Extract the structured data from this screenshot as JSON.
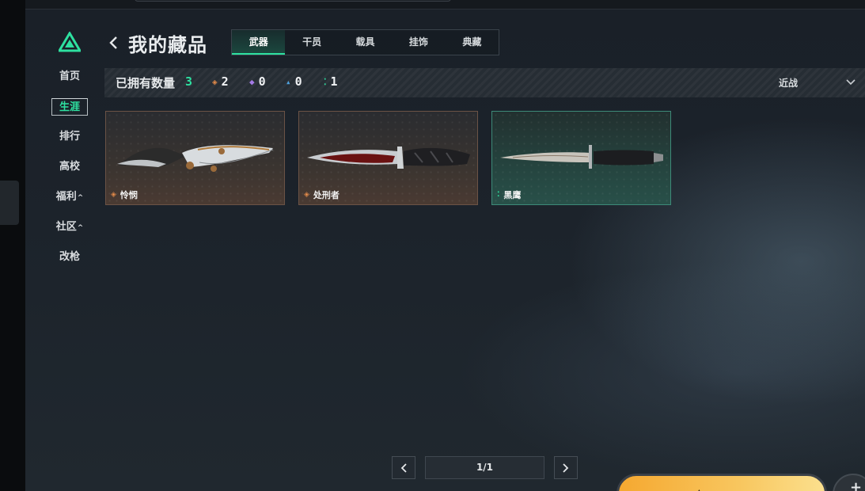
{
  "page": {
    "title": "我的藏品"
  },
  "nav": {
    "items": [
      {
        "label": "首页",
        "caret": ""
      },
      {
        "label": "生涯",
        "caret": "",
        "active": true
      },
      {
        "label": "排行",
        "caret": ""
      },
      {
        "label": "高校",
        "caret": ""
      },
      {
        "label": "福利",
        "caret": "^"
      },
      {
        "label": "社区",
        "caret": "^"
      },
      {
        "label": "改枪",
        "caret": ""
      }
    ]
  },
  "tabs": [
    {
      "label": "武器",
      "active": true
    },
    {
      "label": "干员"
    },
    {
      "label": "载具"
    },
    {
      "label": "挂饰"
    },
    {
      "label": "典藏"
    }
  ],
  "stats": {
    "label": "已拥有数量",
    "total": "3",
    "rarities": [
      {
        "icon": "orange-diamond-icon",
        "glyph": "◈",
        "color": "#e0894a",
        "count": "2"
      },
      {
        "icon": "purple-diamond-icon",
        "glyph": "◆",
        "color": "#a47ae6",
        "count": "0"
      },
      {
        "icon": "blue-chevron-icon",
        "glyph": "▴",
        "color": "#4fa3e0",
        "count": "0"
      },
      {
        "icon": "green-dots-icon",
        "glyph": "⁚",
        "color": "#2ee0a0",
        "count": "1"
      }
    ]
  },
  "filter": {
    "value": "近战"
  },
  "items": [
    {
      "name": "怜悯",
      "rarity_icon": "orange-diamond-icon",
      "rarity_glyph": "◈",
      "rarity_color": "#e0894a",
      "style": "legendary"
    },
    {
      "name": "处刑者",
      "rarity_icon": "orange-diamond-icon",
      "rarity_glyph": "◈",
      "rarity_color": "#e0894a",
      "style": "legendary"
    },
    {
      "name": "黑鹰",
      "rarity_icon": "green-dots-icon",
      "rarity_glyph": "⁚",
      "rarity_color": "#2ee0a0",
      "style": "rare"
    }
  ],
  "pagination": {
    "display": "1/1"
  },
  "colors": {
    "accent": "#2ee0a0",
    "start_button": "#f5a830"
  }
}
